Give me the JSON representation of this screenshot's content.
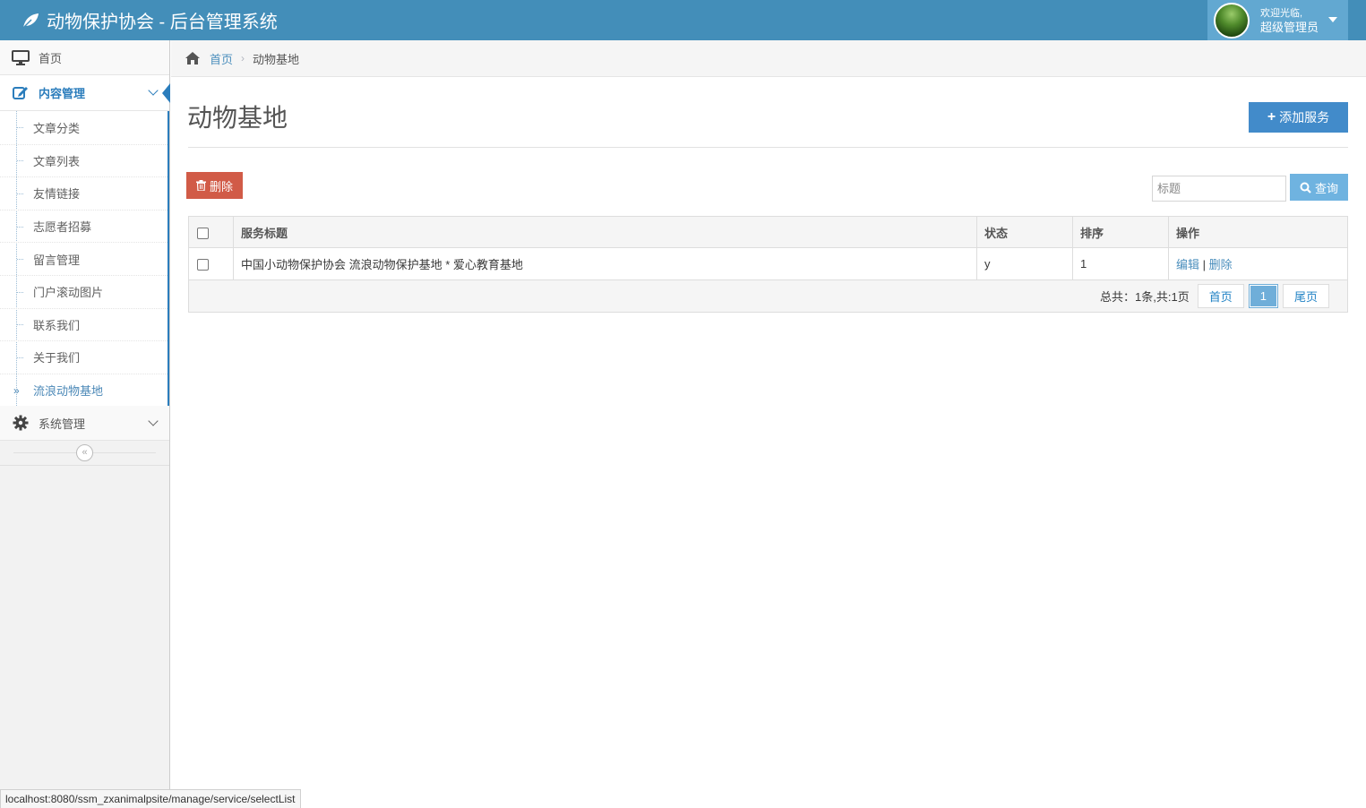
{
  "header": {
    "brand_title": "动物保护协会 - 后台管理系统",
    "welcome": "欢迎光临,",
    "username": "超级管理员",
    "colors": {
      "bar": "#438eb9",
      "user_box": "#62a8d1"
    }
  },
  "sidebar": {
    "home_label": "首页",
    "content_mgmt_label": "内容管理",
    "sub_items": [
      "文章分类",
      "文章列表",
      "友情链接",
      "志愿者招募",
      "留言管理",
      "门户滚动图片",
      "联系我们",
      "关于我们",
      "流浪动物基地"
    ],
    "current_sub": "流浪动物基地",
    "system_mgmt_label": "系统管理",
    "collapse_glyph": "«"
  },
  "breadcrumb": {
    "home": "首页",
    "separator": "›",
    "current": "动物基地"
  },
  "main": {
    "title": "动物基地",
    "add_button": "添加服务",
    "delete_button": "删除",
    "search_placeholder": "标题",
    "search_button": "查询"
  },
  "table": {
    "headers": {
      "title": "服务标题",
      "status": "状态",
      "order": "排序",
      "ops": "操作"
    },
    "rows": [
      {
        "title": "中国小动物保护协会 流浪动物保护基地 * 爱心教育基地",
        "status": "y",
        "order": "1",
        "edit": "编辑",
        "sep": "|",
        "delete": "删除"
      }
    ]
  },
  "pagination": {
    "summary": "总共：1条,共:1页",
    "first": "首页",
    "current": "1",
    "last": "尾页"
  },
  "statusbar": {
    "url": "localhost:8080/ssm_zxanimalpsite/manage/service/selectList"
  }
}
